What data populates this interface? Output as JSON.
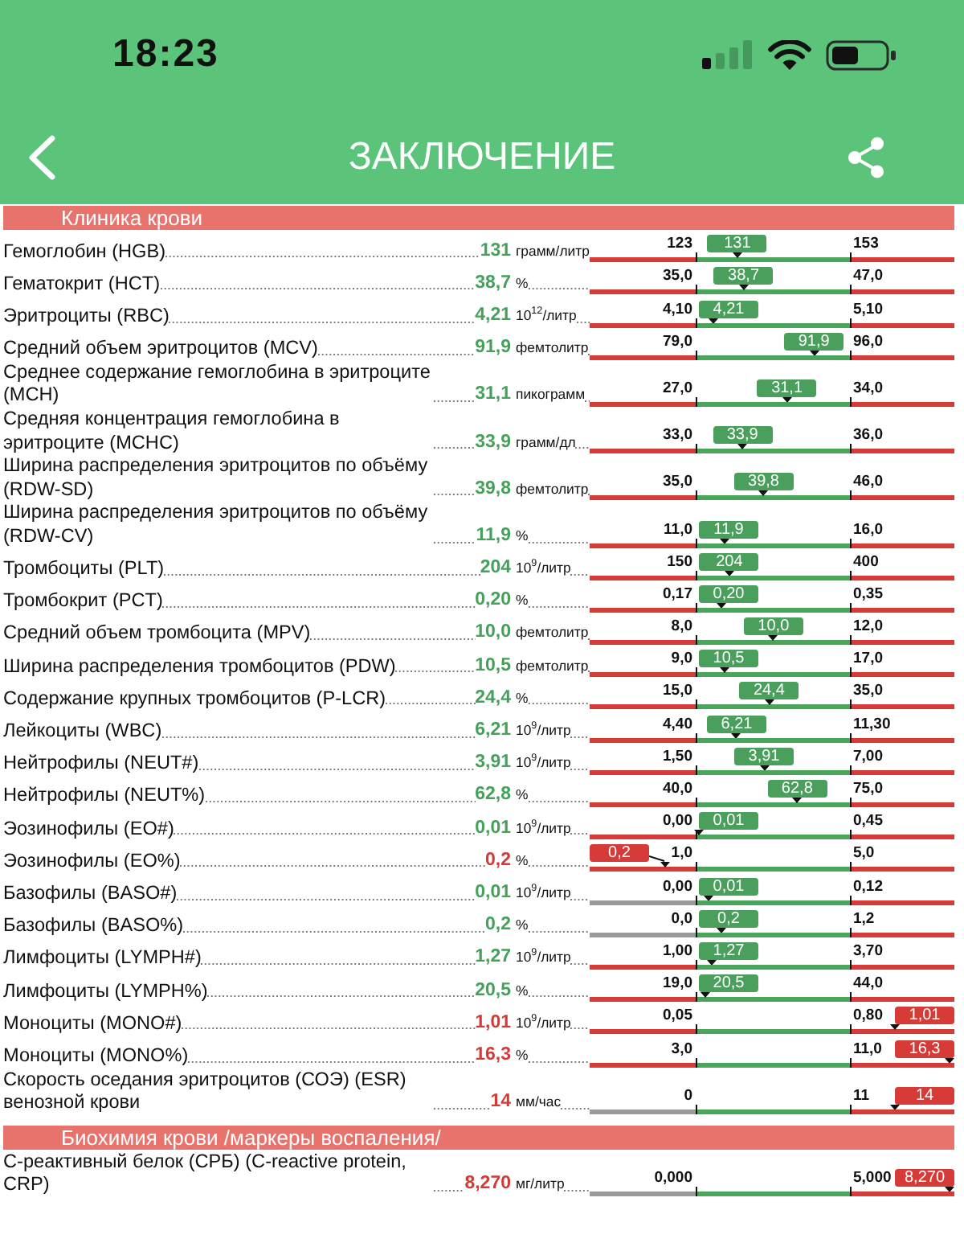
{
  "status_bar": {
    "time": "18:23"
  },
  "header": {
    "title": "ЗАКЛЮЧЕНИЕ"
  },
  "sections": [
    {
      "title": "Клиника крови",
      "rows": [
        {
          "kind": "normal",
          "name": "Гемоглобин (HGB)",
          "value": "131",
          "unit": "грамм/литр",
          "range_low": "123",
          "range_high": "153",
          "badge": "131",
          "level": 0.405,
          "low_zone_neutral": false
        },
        {
          "kind": "normal",
          "name": "Гематокрит (HCT)",
          "value": "38,7",
          "unit": "%",
          "range_low": "35,0",
          "range_high": "47,0",
          "badge": "38,7",
          "level": 0.422,
          "low_zone_neutral": false
        },
        {
          "kind": "normal",
          "name": "Эритроциты (RBC)",
          "value": "4,21",
          "unit": "10$^{12}$/литр",
          "range_low": "4,10",
          "range_high": "5,10",
          "badge": "4,21",
          "level": 0.338,
          "low_zone_neutral": false
        },
        {
          "kind": "normal",
          "name": "Средний объем эритроцитов (MCV)",
          "value": "91,9",
          "unit": "фемтолитр",
          "range_low": "79,0",
          "range_high": "96,0",
          "badge": "91,9",
          "level": 0.615,
          "low_zone_neutral": false
        },
        {
          "kind": "normal",
          "name": "Среднее содержание гемоглобина в эритроците (MCH)",
          "value": "31,1",
          "unit": "пикограмм",
          "range_low": "27,0",
          "range_high": "34,0",
          "badge": "31,1",
          "level": 0.541,
          "low_zone_neutral": false
        },
        {
          "kind": "normal",
          "name": "Средняя концентрация гемоглобина в эритроците (MCHC)",
          "value": "33,9",
          "unit": "грамм/дл",
          "range_low": "33,0",
          "range_high": "36,0",
          "badge": "33,9",
          "level": 0.419,
          "low_zone_neutral": false
        },
        {
          "kind": "normal",
          "name": "Ширина распределения эритроцитов по объёму (RDW-SD)",
          "value": "39,8",
          "unit": "фемтолитр",
          "range_low": "35,0",
          "range_high": "46,0",
          "badge": "39,8",
          "level": 0.477,
          "low_zone_neutral": false
        },
        {
          "kind": "normal",
          "name": "Ширина распределения эритроцитов по объёму (RDW-CV)",
          "value": "11,9",
          "unit": "%",
          "range_low": "11,0",
          "range_high": "16,0",
          "badge": "11,9",
          "level": 0.368,
          "low_zone_neutral": false
        },
        {
          "kind": "normal",
          "name": "Тромбоциты (PLT)",
          "value": "204",
          "unit": "10$^{9}$/литр",
          "range_low": "150",
          "range_high": "400",
          "badge": "204",
          "level": 0.383,
          "low_zone_neutral": false
        },
        {
          "kind": "normal",
          "name": "Тромбокрит (PCT)",
          "value": "0,20",
          "unit": "%",
          "range_low": "0,17",
          "range_high": "0,35",
          "badge": "0,20",
          "level": 0.362,
          "low_zone_neutral": false
        },
        {
          "kind": "normal",
          "name": "Средний объем тромбоцита (MPV)",
          "value": "10,0",
          "unit": "фемтолитр",
          "range_low": "8,0",
          "range_high": "12,0",
          "badge": "10,0",
          "level": 0.504,
          "low_zone_neutral": false
        },
        {
          "kind": "normal",
          "name": "Ширина распределения тромбоцитов (PDW)",
          "value": "10,5",
          "unit": "фемтолитр",
          "range_low": "9,0",
          "range_high": "17,0",
          "badge": "10,5",
          "level": 0.371,
          "low_zone_neutral": false
        },
        {
          "kind": "normal",
          "name": "Содержание крупных тромбоцитов (P-LCR)",
          "value": "24,4",
          "unit": "%",
          "range_low": "15,0",
          "range_high": "35,0",
          "badge": "24,4",
          "level": 0.492,
          "low_zone_neutral": false
        },
        {
          "kind": "normal",
          "name": "Лейкоциты (WBC)",
          "value": "6,21",
          "unit": "10$^{9}$/литр",
          "range_low": "4,40",
          "range_high": "11,30",
          "badge": "6,21",
          "level": 0.403,
          "low_zone_neutral": false
        },
        {
          "kind": "normal",
          "name": "Нейтрофилы (NEUT#)",
          "value": "3,91",
          "unit": "10$^{9}$/литр",
          "range_low": "1,50",
          "range_high": "7,00",
          "badge": "3,91",
          "level": 0.478,
          "low_zone_neutral": false
        },
        {
          "kind": "normal",
          "name": "Нейтрофилы (NEUT%)",
          "value": "62,8",
          "unit": "%",
          "range_low": "40,0",
          "range_high": "75,0",
          "badge": "62,8",
          "level": 0.569,
          "low_zone_neutral": false
        },
        {
          "kind": "normal",
          "name": "Эозинофилы (EO#)",
          "value": "0,01",
          "unit": "10$^{9}$/литр",
          "range_low": "0,00",
          "range_high": "0,45",
          "badge": "0,01",
          "level": 0.3,
          "low_zone_neutral": false
        },
        {
          "kind": "low",
          "name": "Эозинофилы (EO%)",
          "value": "0,2",
          "unit": "%",
          "range_low": "1,0",
          "range_high": "5,0",
          "badge": "0,2",
          "level": 0.205,
          "low_zone_neutral": false
        },
        {
          "kind": "normal",
          "name": "Базофилы (BASO#)",
          "value": "0,01",
          "unit": "10$^{9}$/литр",
          "range_low": "0,00",
          "range_high": "0,12",
          "badge": "0,01",
          "level": 0.326,
          "low_zone_neutral": true
        },
        {
          "kind": "normal",
          "name": "Базофилы (BASO%)",
          "value": "0,2",
          "unit": "%",
          "range_low": "0,0",
          "range_high": "1,2",
          "badge": "0,2",
          "level": 0.362,
          "low_zone_neutral": true
        },
        {
          "kind": "normal",
          "name": "Лимфоциты (LYMPH#)",
          "value": "1,27",
          "unit": "10$^{9}$/литр",
          "range_low": "1,00",
          "range_high": "3,70",
          "badge": "1,27",
          "level": 0.333,
          "low_zone_neutral": false
        },
        {
          "kind": "normal",
          "name": "Лимфоциты (LYMPH%)",
          "value": "20,5",
          "unit": "%",
          "range_low": "19,0",
          "range_high": "44,0",
          "badge": "20,5",
          "level": 0.316,
          "low_zone_neutral": false
        },
        {
          "kind": "high",
          "name": "Моноциты (MONO#)",
          "value": "1,01",
          "unit": "10$^{9}$/литр",
          "range_low": "0,05",
          "range_high": "0,80",
          "badge": "1,01",
          "level": 0.838,
          "low_zone_neutral": false
        },
        {
          "kind": "high",
          "name": "Моноциты (MONO%)",
          "value": "16,3",
          "unit": "%",
          "range_low": "3,0",
          "range_high": "11,0",
          "badge": "16,3",
          "level": 0.99,
          "low_zone_neutral": false
        },
        {
          "kind": "high",
          "name": "Скорость оседания эритроцитов (СОЭ) (ESR) венозной крови",
          "value": "14",
          "unit": "мм/час",
          "range_low": "0",
          "range_high": "11",
          "badge": "14",
          "level": 0.835,
          "low_zone_neutral": true
        }
      ]
    },
    {
      "title": "Биохимия крови /маркеры воспаления/",
      "rows": [
        {
          "kind": "high",
          "name": "С-реактивный белок (СРБ) (C-reactive protein, CRP)",
          "value": "8,270",
          "unit": "мг/литр",
          "range_low": "0,000",
          "range_high": "5,000",
          "badge": "8,270",
          "level": 0.99,
          "low_zone_neutral": true
        }
      ]
    }
  ]
}
